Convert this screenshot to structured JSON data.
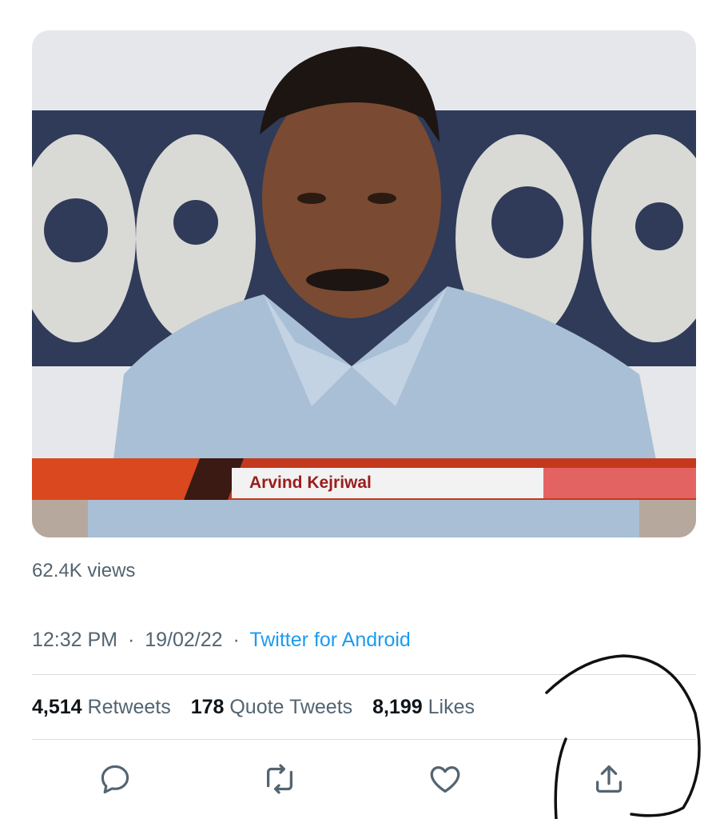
{
  "media": {
    "lower_third_name": "Arvind Kejriwal"
  },
  "tweet": {
    "views": "62.4K views",
    "time": "12:32 PM",
    "date": "19/02/22",
    "separator": "·",
    "source": "Twitter for Android"
  },
  "stats": {
    "retweets_count": "4,514",
    "retweets_label": "Retweets",
    "quotes_count": "178",
    "quotes_label": "Quote Tweets",
    "likes_count": "8,199",
    "likes_label": "Likes"
  },
  "actions": [
    {
      "icon": "reply-icon"
    },
    {
      "icon": "retweet-icon"
    },
    {
      "icon": "like-icon"
    },
    {
      "icon": "share-icon"
    }
  ],
  "colors": {
    "accent": "#1d9bf0",
    "secondary_text": "#536471",
    "primary_text": "#0f1419"
  }
}
